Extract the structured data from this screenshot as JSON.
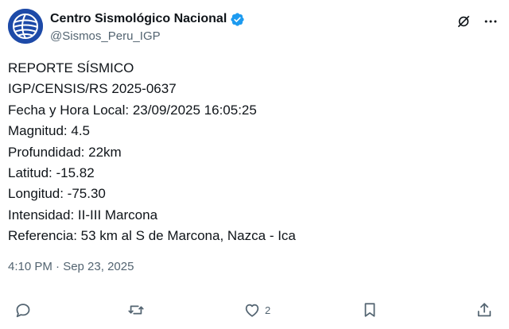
{
  "author": {
    "display_name": "Centro Sismológico Nacional",
    "handle": "@Sismos_Peru_IGP",
    "verified": true,
    "avatar_icon": "globe-logo-icon"
  },
  "post": {
    "lines": [
      "REPORTE SÍSMICO",
      "IGP/CENSIS/RS 2025-0637",
      "Fecha y Hora Local: 23/09/2025 16:05:25",
      "Magnitud: 4.5",
      "Profundidad: 22km",
      "Latitud: -15.82",
      "Longitud: -75.30",
      "Intensidad: II-III Marcona",
      "Referencia: 53 km al S de Marcona, Nazca - Ica"
    ],
    "timestamp": "4:10 PM · Sep 23, 2025"
  },
  "actions": {
    "reply_icon": "reply-icon",
    "repost_icon": "repost-icon",
    "like_icon": "like-icon",
    "like_count": "2",
    "bookmark_icon": "bookmark-icon",
    "share_icon": "share-icon"
  },
  "top_actions": {
    "grok_icon": "grok-icon",
    "more_icon": "more-icon"
  },
  "colors": {
    "text": "#0f1419",
    "secondary": "#536471",
    "verified": "#1d9bf0",
    "avatar_bg": "#1d4aa8"
  }
}
